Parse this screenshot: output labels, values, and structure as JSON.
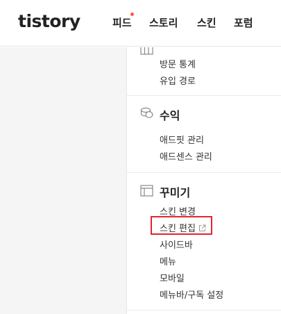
{
  "header": {
    "logo": "tistory",
    "nav": {
      "feed": "피드",
      "story": "스토리",
      "skin": "스킨",
      "forum": "포럼"
    },
    "feed_badge_color": "#ff5544"
  },
  "sidebar": {
    "stats": {
      "items": [
        "방문 통계",
        "유입 경로"
      ]
    },
    "revenue": {
      "title": "수익",
      "items": [
        "애드핏 관리",
        "애드센스 관리"
      ]
    },
    "decorate": {
      "title": "꾸미기",
      "items": [
        "스킨 변경",
        "스킨 편집",
        "사이드바",
        "메뉴",
        "모바일",
        "메뉴바/구독 설정"
      ]
    }
  },
  "highlight_color": "#e0252f"
}
